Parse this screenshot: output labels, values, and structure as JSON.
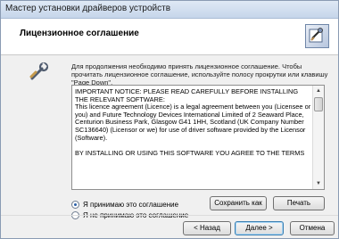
{
  "window": {
    "title": "Мастер установки драйверов устройств"
  },
  "header": {
    "title": "Лицензионное соглашение",
    "icon": "installer-icon"
  },
  "intro": {
    "text": "Для продолжения необходимо принять лицензионное соглашение. Чтобы прочитать лицензионное соглашение, используйте полосу прокрутки или клавишу \"Page Down\"."
  },
  "license": {
    "lines": [
      "IMPORTANT NOTICE: PLEASE READ CAREFULLY BEFORE INSTALLING THE RELEVANT SOFTWARE:",
      "This licence agreement (Licence) is a legal agreement between you (Licensee or you) and Future Technology Devices International Limited of 2 Seaward Place, Centurion Business Park, Glasgow G41 1HH, Scotland (UK Company Number SC136640) (Licensor or we) for use of driver software provided by the Licensor (Software).",
      "BY INSTALLING OR USING THIS SOFTWARE YOU AGREE TO THE TERMS"
    ]
  },
  "options": {
    "accept": "Я принимаю это соглашение",
    "decline": "Я не принимаю это соглашение",
    "selected": "accept"
  },
  "buttons": {
    "save": "Сохранить как",
    "print": "Печать",
    "back": "< Назад",
    "next": "Далее >",
    "cancel": "Отмена"
  },
  "colors": {
    "accent": "#2b5fa8"
  }
}
